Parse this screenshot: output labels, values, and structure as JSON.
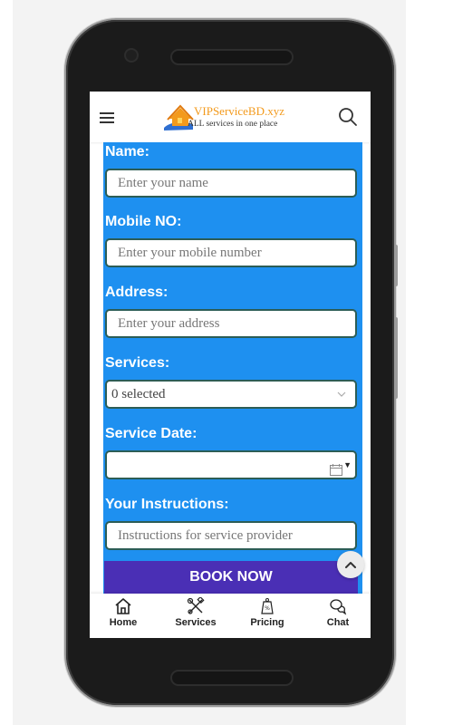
{
  "header": {
    "logo_title": "VIPServiceBD.xyz",
    "logo_subtitle": "ALL services in one place",
    "menu_icon": "hamburger-menu-icon",
    "search_icon": "search-icon"
  },
  "form": {
    "name_label": "Name:",
    "name_placeholder": "Enter your name",
    "mobile_label": "Mobile NO:",
    "mobile_placeholder": "Enter your mobile number",
    "address_label": "Address:",
    "address_placeholder": "Enter your address",
    "services_label": "Services:",
    "services_value": "0 selected",
    "date_label": "Service Date:",
    "date_value": "",
    "instructions_label": "Your Instructions:",
    "instructions_placeholder": "Instructions for service provider",
    "submit_label": "BOOK NOW"
  },
  "bottom_nav": {
    "items": [
      {
        "label": "Home",
        "icon": "home-icon"
      },
      {
        "label": "Services",
        "icon": "tools-icon"
      },
      {
        "label": "Pricing",
        "icon": "price-tag-icon"
      },
      {
        "label": "Chat",
        "icon": "chat-icon"
      }
    ]
  },
  "colors": {
    "form_background": "#1e90f0",
    "button": "#4a2fb5",
    "logo_orange": "#f39a1c",
    "field_border": "#2c5d56"
  }
}
